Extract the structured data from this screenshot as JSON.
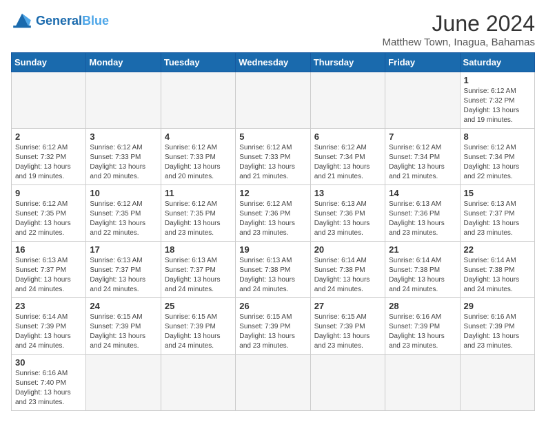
{
  "header": {
    "logo_general": "General",
    "logo_blue": "Blue",
    "title": "June 2024",
    "subtitle": "Matthew Town, Inagua, Bahamas"
  },
  "days_of_week": [
    "Sunday",
    "Monday",
    "Tuesday",
    "Wednesday",
    "Thursday",
    "Friday",
    "Saturday"
  ],
  "weeks": [
    [
      {
        "day": "",
        "info": ""
      },
      {
        "day": "",
        "info": ""
      },
      {
        "day": "",
        "info": ""
      },
      {
        "day": "",
        "info": ""
      },
      {
        "day": "",
        "info": ""
      },
      {
        "day": "",
        "info": ""
      },
      {
        "day": "1",
        "info": "Sunrise: 6:12 AM\nSunset: 7:32 PM\nDaylight: 13 hours\nand 19 minutes."
      }
    ],
    [
      {
        "day": "2",
        "info": "Sunrise: 6:12 AM\nSunset: 7:32 PM\nDaylight: 13 hours\nand 19 minutes."
      },
      {
        "day": "3",
        "info": "Sunrise: 6:12 AM\nSunset: 7:33 PM\nDaylight: 13 hours\nand 20 minutes."
      },
      {
        "day": "4",
        "info": "Sunrise: 6:12 AM\nSunset: 7:33 PM\nDaylight: 13 hours\nand 20 minutes."
      },
      {
        "day": "5",
        "info": "Sunrise: 6:12 AM\nSunset: 7:33 PM\nDaylight: 13 hours\nand 21 minutes."
      },
      {
        "day": "6",
        "info": "Sunrise: 6:12 AM\nSunset: 7:34 PM\nDaylight: 13 hours\nand 21 minutes."
      },
      {
        "day": "7",
        "info": "Sunrise: 6:12 AM\nSunset: 7:34 PM\nDaylight: 13 hours\nand 21 minutes."
      },
      {
        "day": "8",
        "info": "Sunrise: 6:12 AM\nSunset: 7:34 PM\nDaylight: 13 hours\nand 22 minutes."
      }
    ],
    [
      {
        "day": "9",
        "info": "Sunrise: 6:12 AM\nSunset: 7:35 PM\nDaylight: 13 hours\nand 22 minutes."
      },
      {
        "day": "10",
        "info": "Sunrise: 6:12 AM\nSunset: 7:35 PM\nDaylight: 13 hours\nand 22 minutes."
      },
      {
        "day": "11",
        "info": "Sunrise: 6:12 AM\nSunset: 7:35 PM\nDaylight: 13 hours\nand 23 minutes."
      },
      {
        "day": "12",
        "info": "Sunrise: 6:12 AM\nSunset: 7:36 PM\nDaylight: 13 hours\nand 23 minutes."
      },
      {
        "day": "13",
        "info": "Sunrise: 6:13 AM\nSunset: 7:36 PM\nDaylight: 13 hours\nand 23 minutes."
      },
      {
        "day": "14",
        "info": "Sunrise: 6:13 AM\nSunset: 7:36 PM\nDaylight: 13 hours\nand 23 minutes."
      },
      {
        "day": "15",
        "info": "Sunrise: 6:13 AM\nSunset: 7:37 PM\nDaylight: 13 hours\nand 23 minutes."
      }
    ],
    [
      {
        "day": "16",
        "info": "Sunrise: 6:13 AM\nSunset: 7:37 PM\nDaylight: 13 hours\nand 24 minutes."
      },
      {
        "day": "17",
        "info": "Sunrise: 6:13 AM\nSunset: 7:37 PM\nDaylight: 13 hours\nand 24 minutes."
      },
      {
        "day": "18",
        "info": "Sunrise: 6:13 AM\nSunset: 7:37 PM\nDaylight: 13 hours\nand 24 minutes."
      },
      {
        "day": "19",
        "info": "Sunrise: 6:13 AM\nSunset: 7:38 PM\nDaylight: 13 hours\nand 24 minutes."
      },
      {
        "day": "20",
        "info": "Sunrise: 6:14 AM\nSunset: 7:38 PM\nDaylight: 13 hours\nand 24 minutes."
      },
      {
        "day": "21",
        "info": "Sunrise: 6:14 AM\nSunset: 7:38 PM\nDaylight: 13 hours\nand 24 minutes."
      },
      {
        "day": "22",
        "info": "Sunrise: 6:14 AM\nSunset: 7:38 PM\nDaylight: 13 hours\nand 24 minutes."
      }
    ],
    [
      {
        "day": "23",
        "info": "Sunrise: 6:14 AM\nSunset: 7:39 PM\nDaylight: 13 hours\nand 24 minutes."
      },
      {
        "day": "24",
        "info": "Sunrise: 6:15 AM\nSunset: 7:39 PM\nDaylight: 13 hours\nand 24 minutes."
      },
      {
        "day": "25",
        "info": "Sunrise: 6:15 AM\nSunset: 7:39 PM\nDaylight: 13 hours\nand 24 minutes."
      },
      {
        "day": "26",
        "info": "Sunrise: 6:15 AM\nSunset: 7:39 PM\nDaylight: 13 hours\nand 23 minutes."
      },
      {
        "day": "27",
        "info": "Sunrise: 6:15 AM\nSunset: 7:39 PM\nDaylight: 13 hours\nand 23 minutes."
      },
      {
        "day": "28",
        "info": "Sunrise: 6:16 AM\nSunset: 7:39 PM\nDaylight: 13 hours\nand 23 minutes."
      },
      {
        "day": "29",
        "info": "Sunrise: 6:16 AM\nSunset: 7:39 PM\nDaylight: 13 hours\nand 23 minutes."
      }
    ],
    [
      {
        "day": "30",
        "info": "Sunrise: 6:16 AM\nSunset: 7:40 PM\nDaylight: 13 hours\nand 23 minutes."
      },
      {
        "day": "",
        "info": ""
      },
      {
        "day": "",
        "info": ""
      },
      {
        "day": "",
        "info": ""
      },
      {
        "day": "",
        "info": ""
      },
      {
        "day": "",
        "info": ""
      },
      {
        "day": "",
        "info": ""
      }
    ]
  ]
}
